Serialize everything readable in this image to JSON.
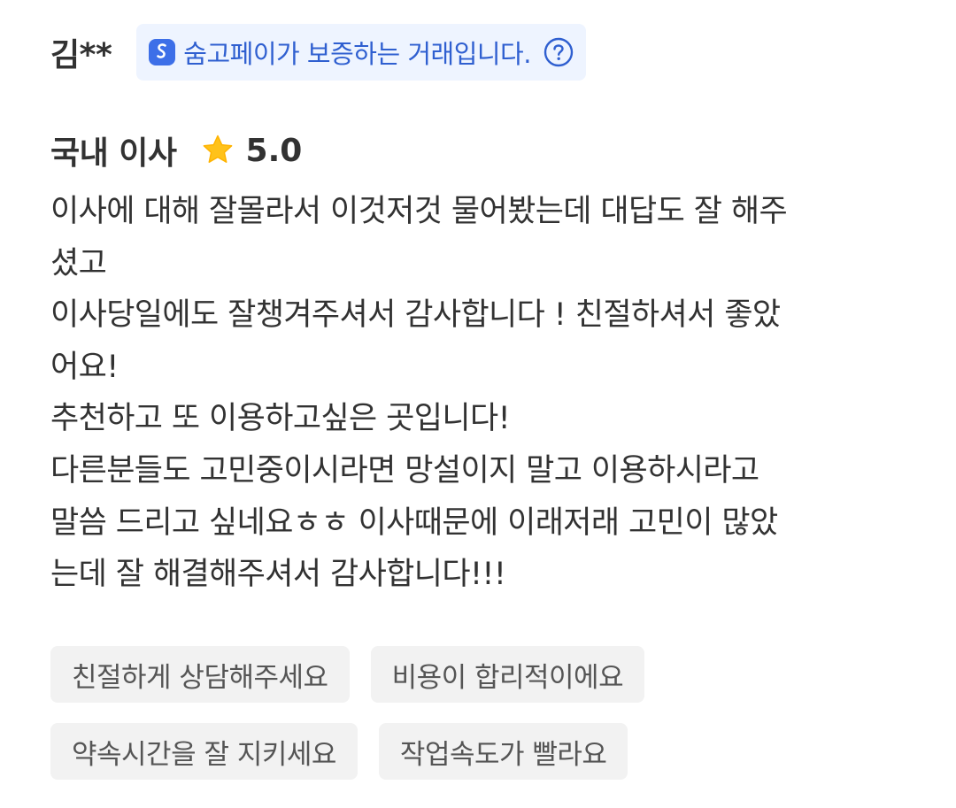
{
  "review": {
    "reviewer_name": "김**",
    "guarantee_text": "숨고페이가 보증하는 거래입니다.",
    "service": "국내 이사",
    "rating": "5.0",
    "body_lines": [
      "이사에 대해 잘몰라서 이것저것 물어봤는데 대답도 잘 해주",
      "셨고",
      "이사당일에도  잘챙겨주셔서 감사합니다 ! 친절하셔서 좋았",
      "어요!",
      "추천하고 또 이용하고싶은 곳입니다!",
      "다른분들도 고민중이시라면 망설이지 말고 이용하시라고",
      "말씀 드리고 싶네요ㅎㅎ 이사때문에 이래저래 고민이 많았",
      "는데 잘 해결해주셔서 감사합니다!!!"
    ],
    "tags": [
      "친절하게 상담해주세요",
      "비용이 합리적이에요",
      "약속시간을 잘 지키세요",
      "작업속도가 빨라요"
    ]
  },
  "icons": {
    "pay_logo": "soomgo-pay-logo-icon",
    "help": "question-circle-icon",
    "star": "star-icon"
  },
  "colors": {
    "guarantee_bg": "#eef4ff",
    "guarantee_text": "#2f5fd0",
    "star": "#ffc21a",
    "chip_bg": "#f2f2f2",
    "text": "#323232"
  }
}
